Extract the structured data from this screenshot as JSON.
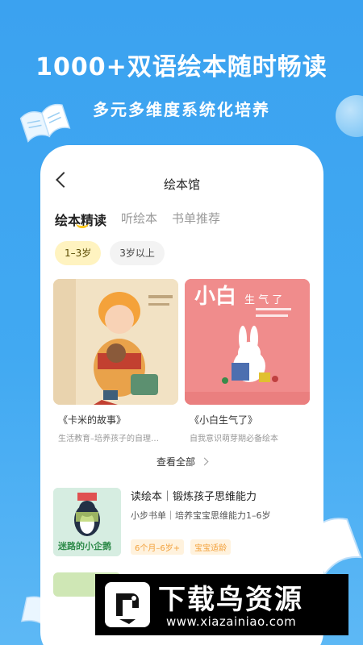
{
  "promo": {
    "headline": "1000+双语绘本随时畅读",
    "subline": "多元多维度系统化培养"
  },
  "app": {
    "nav_title": "绘本馆",
    "tabs": [
      {
        "label": "绘本精读",
        "active": true
      },
      {
        "label": "听绘本",
        "active": false
      },
      {
        "label": "书单推荐",
        "active": false
      }
    ],
    "age_chips": [
      {
        "label": "1–3岁",
        "active": true
      },
      {
        "label": "3岁以上",
        "active": false
      }
    ],
    "books": [
      {
        "title": "《卡米的故事》",
        "desc": "生活教育–培养孩子的自理…"
      },
      {
        "title": "《小白生气了》",
        "desc": "自我意识萌芽期必备绘本",
        "cover_text": "小白",
        "cover_text2": "生 气 了"
      }
    ],
    "see_all": "查看全部",
    "list": [
      {
        "title": "读绘本｜锻炼孩子思维能力",
        "subtitle": "小步书单｜培养宝宝思维能力1–6岁",
        "cover_text": "迷路的小企鹅",
        "tags": [
          "6个月–6岁+",
          "宝宝适龄"
        ]
      }
    ]
  },
  "watermark": {
    "title": "下载鸟资源",
    "url": "www.xiazainiao.com"
  },
  "colors": {
    "background": "#3FA5F0",
    "accent_yellow": "#FFC91E",
    "tag_orange": "#F2A13C"
  }
}
